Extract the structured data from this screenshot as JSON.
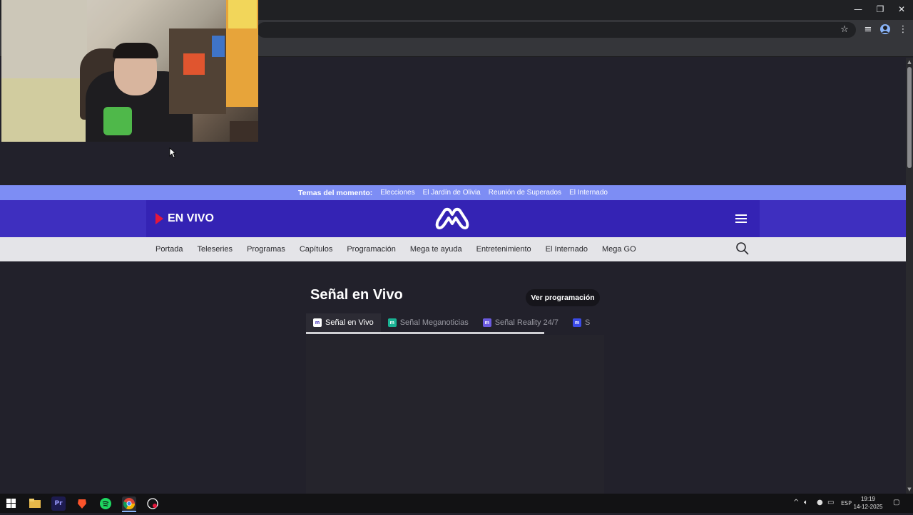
{
  "window": {
    "minimize": "—",
    "restore": "❐",
    "close": "✕"
  },
  "toolbar": {
    "bookmark_icon": "star-icon",
    "tabsearch_icon": "media-queue-icon",
    "profile_icon": "profile-avatar-icon",
    "menu_icon": "kebab-menu-icon"
  },
  "site": {
    "trending_title": "Temas del momento:",
    "trending_links": [
      "Elecciones",
      "El Jardín de Olivia",
      "Reunión de Superados",
      "El Internado"
    ],
    "live_label": "EN VIVO",
    "nav_links": [
      "Portada",
      "Teleseries",
      "Programas",
      "Capítulos",
      "Programación",
      "Mega te ayuda",
      "Entretenimiento",
      "El Internado",
      "Mega GO"
    ],
    "page_title": "Señal en Vivo",
    "schedule_button": "Ver programación",
    "tabs": [
      {
        "label": "Señal en Vivo",
        "color": "#ffffff",
        "active": true
      },
      {
        "label": "Señal Meganoticias",
        "color": "#19b394",
        "active": false
      },
      {
        "label": "Señal Reality 24/7",
        "color": "#6b5ae0",
        "active": false
      },
      {
        "label": "S",
        "color": "#3b4be8",
        "active": false
      }
    ]
  },
  "taskbar": {
    "apps": [
      "start-icon",
      "file-explorer-icon",
      "premiere-icon",
      "brave-icon",
      "spotify-icon",
      "chrome-icon",
      "recorder-icon"
    ],
    "premiere_label": "Pr",
    "language": "ESP",
    "time": "19:19",
    "date": "14-12-2025"
  },
  "colors": {
    "accent": "#3423b4",
    "trending": "#7d8df4",
    "live": "#e4173b"
  }
}
